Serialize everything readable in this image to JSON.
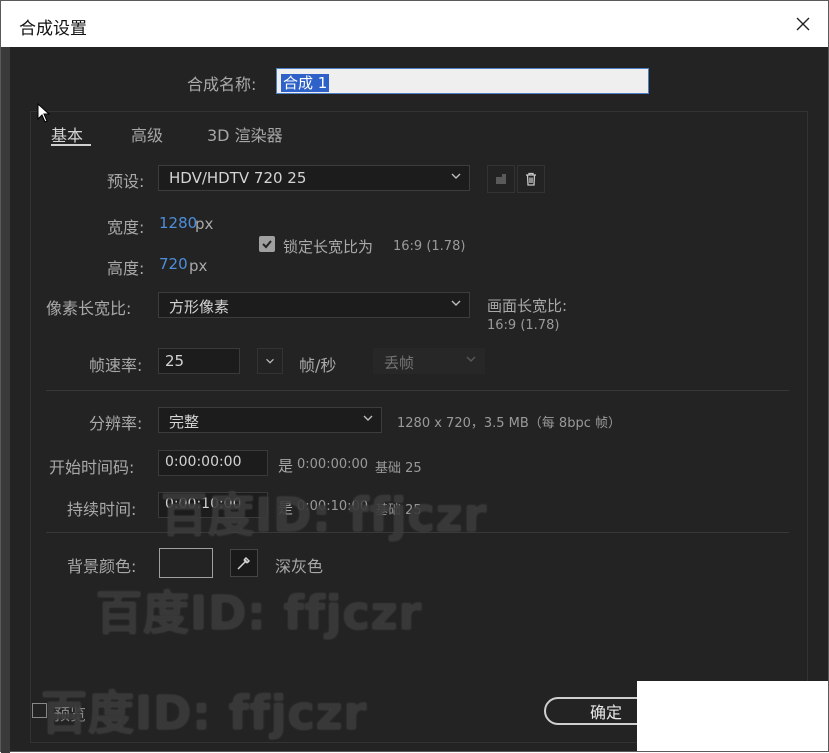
{
  "window": {
    "title": "合成设置"
  },
  "composition_name": {
    "label": "合成名称:",
    "value": "合成 1"
  },
  "tabs": [
    {
      "label": "基本",
      "active": true
    },
    {
      "label": "高级",
      "active": false
    },
    {
      "label": "3D 渲染器",
      "active": false
    }
  ],
  "preset": {
    "label": "预设:",
    "value": "HDV/HDTV 720 25"
  },
  "width": {
    "label": "宽度:",
    "value": "1280",
    "unit": "px"
  },
  "height": {
    "label": "高度:",
    "value": "720",
    "unit": "px"
  },
  "lock_ratio": {
    "checked": true,
    "label": "锁定长宽比为",
    "value": "16:9 (1.78)"
  },
  "pixel_aspect": {
    "label": "像素长宽比:",
    "value": "方形像素",
    "frame_label": "画面长宽比:",
    "frame_value": "16:9 (1.78)"
  },
  "frame_rate": {
    "label": "帧速率:",
    "value": "25",
    "unit": "帧/秒",
    "drop_frame": "丢帧"
  },
  "resolution": {
    "label": "分辨率:",
    "value": "完整",
    "info": "1280 x 720，3.5 MB（每 8bpc 帧）"
  },
  "start_timecode": {
    "label": "开始时间码:",
    "value": "0:00:00:00",
    "note_prefix": "是",
    "note_value": "0:00:00:00",
    "note_suffix": "基础 25"
  },
  "duration": {
    "label": "持续时间:",
    "value": "0:00:10:00",
    "note_prefix": "是",
    "note_value": "0:00:10:00",
    "note_suffix": "基础 25"
  },
  "background": {
    "label": "背景颜色:",
    "color_name": "深灰色",
    "color": "#232323"
  },
  "footer": {
    "preview_label": "预览",
    "ok_label": "确定"
  },
  "watermark": "百度ID: ffjczr",
  "colors": {
    "accent_blue": "#4d8fdc",
    "selection": "#2f62c9",
    "bg": "#232323"
  }
}
